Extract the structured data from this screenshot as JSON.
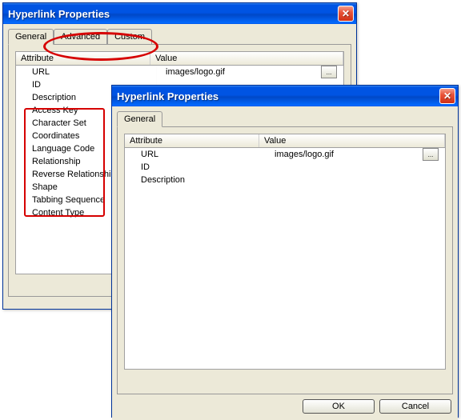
{
  "window_back": {
    "title": "Hyperlink Properties",
    "tabs": [
      "General",
      "Advanced",
      "Custom"
    ],
    "grid": {
      "headers": {
        "attr": "Attribute",
        "val": "Value"
      },
      "rows": [
        {
          "attr": "URL",
          "val": "images/logo.gif",
          "browse": true
        },
        {
          "attr": "ID",
          "val": ""
        },
        {
          "attr": "Description",
          "val": ""
        },
        {
          "attr": "Access Key",
          "val": ""
        },
        {
          "attr": "Character Set",
          "val": ""
        },
        {
          "attr": "Coordinates",
          "val": ""
        },
        {
          "attr": "Language Code",
          "val": ""
        },
        {
          "attr": "Relationship",
          "val": ""
        },
        {
          "attr": "Reverse Relationship",
          "val": ""
        },
        {
          "attr": "Shape",
          "val": ""
        },
        {
          "attr": "Tabbing Sequence",
          "val": ""
        },
        {
          "attr": "Content Type",
          "val": ""
        }
      ]
    }
  },
  "window_front": {
    "title": "Hyperlink Properties",
    "tabs": [
      "General"
    ],
    "grid": {
      "headers": {
        "attr": "Attribute",
        "val": "Value"
      },
      "rows": [
        {
          "attr": "URL",
          "val": "images/logo.gif",
          "browse": true
        },
        {
          "attr": "ID",
          "val": ""
        },
        {
          "attr": "Description",
          "val": ""
        }
      ]
    },
    "buttons": {
      "ok": "OK",
      "cancel": "Cancel"
    }
  },
  "browse_label": "..."
}
